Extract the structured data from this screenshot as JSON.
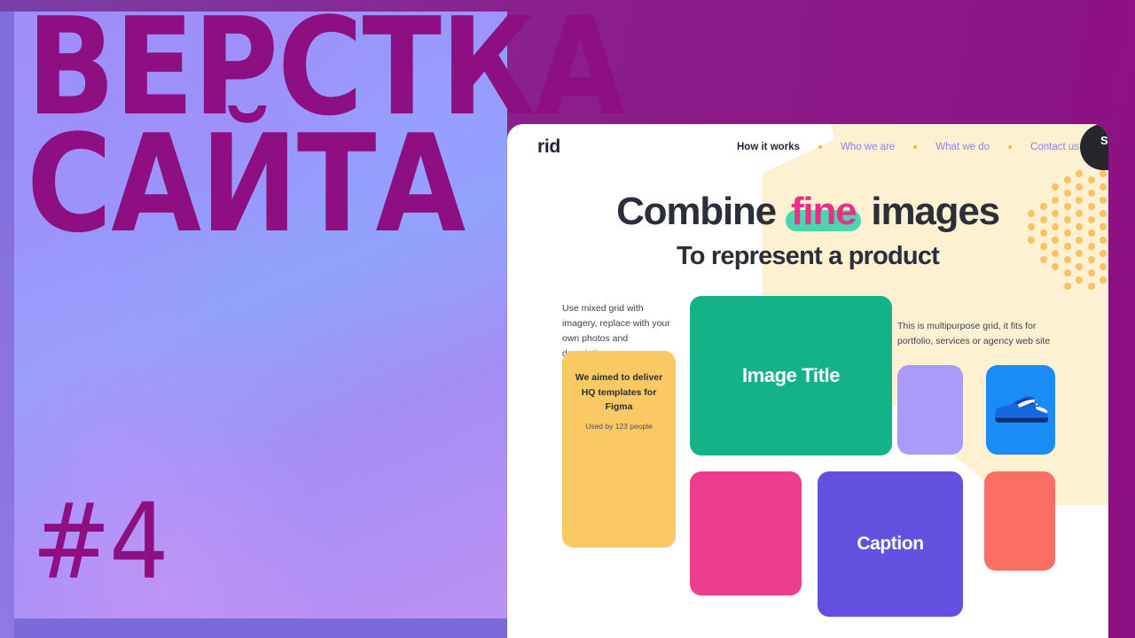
{
  "thumbnail": {
    "title_line1": "ВЕРСТКА",
    "title_line2": "САЙТА",
    "episode": "#4",
    "title_color": "#8d0f82",
    "frame_color": "#8b1f8b",
    "panel_gradient": "#a18df8 → #8fa4fb → #bb92f2"
  },
  "site": {
    "nav": {
      "logo": "rid",
      "links": [
        {
          "label": "How it works",
          "active": true
        },
        {
          "label": "Who we are",
          "active": false
        },
        {
          "label": "What we do",
          "active": false
        },
        {
          "label": "Contact us",
          "active": false
        }
      ],
      "separator_color": "#f6b451",
      "link_color": "#8b82f0",
      "signin_label": "Sign In",
      "signin_bg": "#26262e"
    },
    "hero": {
      "line1_pre": "Combine ",
      "line1_highlight": "fine",
      "line1_post": " images",
      "line2": "To represent a product",
      "highlight_text_color": "#ee2d85",
      "highlight_bg_color": "#4ad6b0",
      "heading_color": "#2b2f38",
      "backdrop_color": "#fdf1d2",
      "dot_color": "#fac264"
    },
    "grid": {
      "left_copy": "Use mixed grid with imagery, replace with your own photos and descriptions",
      "right_copy": "This is multipurpose grid, it fits for portfolio, services or agency web site",
      "note_card": {
        "title": "We aimed to deliver HQ templates for Figma",
        "subtitle": "Used by 123 people",
        "color": "#fbc963"
      },
      "cards": [
        {
          "name": "image-title-card",
          "label": "Image Title",
          "color": "#13b288"
        },
        {
          "name": "lavender-card",
          "label": "",
          "color": "#a99bf7"
        },
        {
          "name": "sneaker-card",
          "label": "",
          "color": "#1a8cf5"
        },
        {
          "name": "pink-card",
          "label": "",
          "color": "#ed3e8e"
        },
        {
          "name": "caption-card",
          "label": "Caption",
          "color": "#6350e0"
        },
        {
          "name": "coral-card",
          "label": "",
          "color": "#fc6e64"
        }
      ]
    }
  }
}
